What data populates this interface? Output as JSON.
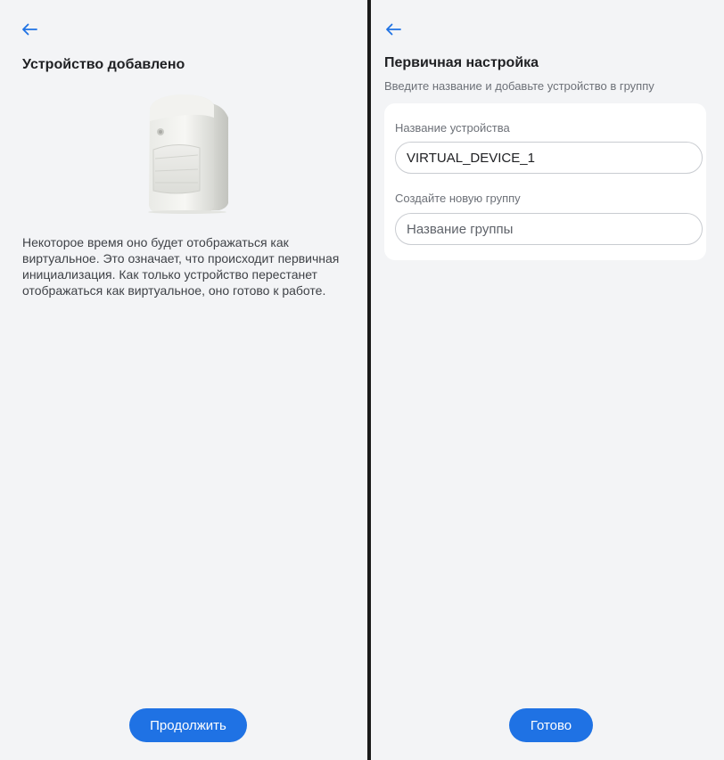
{
  "left_screen": {
    "title": "Устройство добавлено",
    "description": "Некоторое время оно будет отображаться как виртуальное. Это означает, что происходит первичная инициализация. Как только устройство перестанет отображаться как виртуальное, оно готово к работе.",
    "continue_label": "Продолжить"
  },
  "right_screen": {
    "title": "Первичная настройка",
    "subtitle": "Введите название и добавьте устройство в группу",
    "device_name_label": "Название устройства",
    "device_name_value": "VIRTUAL_DEVICE_1",
    "new_group_label": "Создайте новую группу",
    "group_name_placeholder": "Название группы",
    "done_label": "Готово"
  },
  "colors": {
    "accent": "#1f72e4",
    "background": "#f3f4f6",
    "card": "#ffffff",
    "divider": "#1a1a1a"
  },
  "icons": {
    "back": "arrow-left-icon"
  }
}
